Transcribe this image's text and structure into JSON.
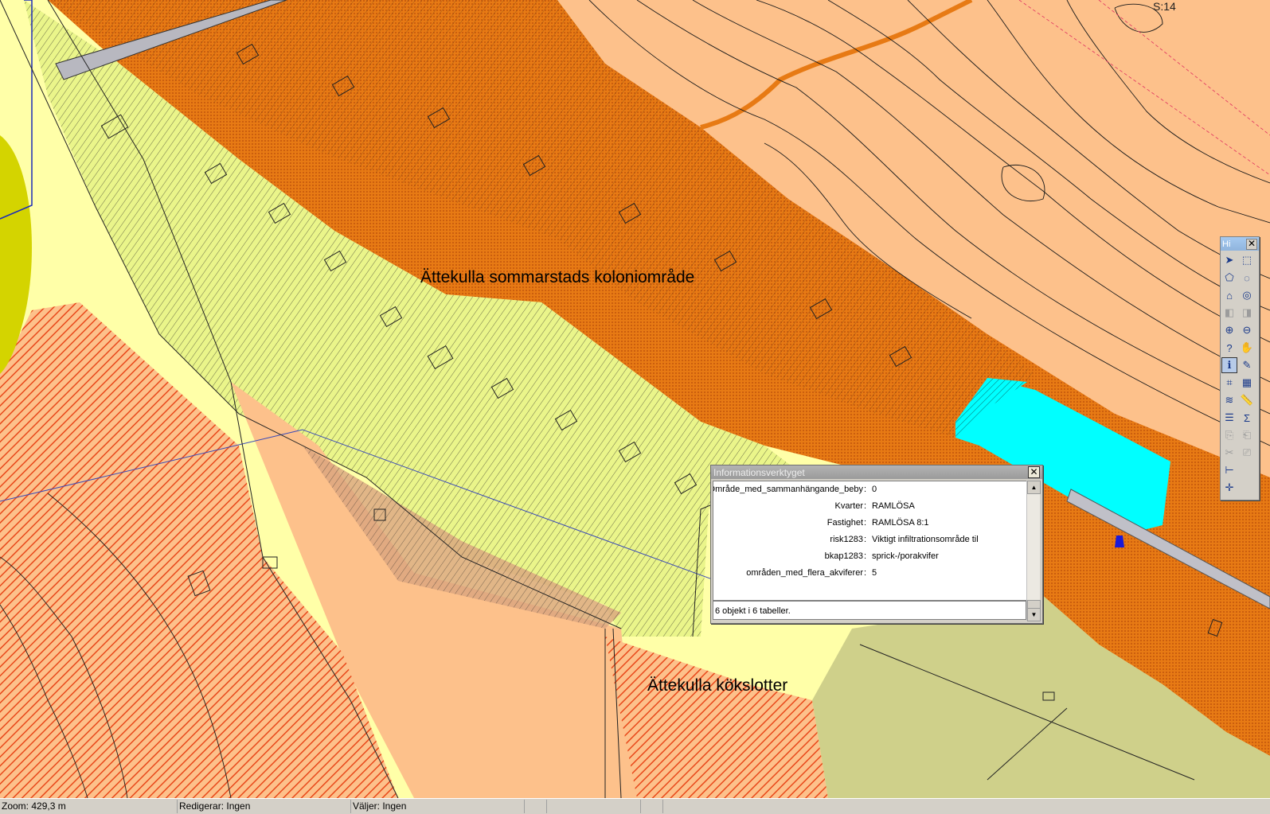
{
  "map": {
    "labels": {
      "koloni": "Ättekulla sommarstads koloniområde",
      "kokslotter": "Ättekulla kökslotter"
    },
    "grid_label": "S:14",
    "colors": {
      "bright_yellow": "#ffffa8",
      "light_orange": "#fdc18b",
      "dark_orange": "#e77a14",
      "olive": "#cfd08a",
      "cyan": "#00ffff",
      "yellow_green": "#d4d400",
      "grey_road": "#b8b8c0"
    }
  },
  "toolbox": {
    "title": "Hi",
    "tools": [
      {
        "name": "select-arrow-icon",
        "glyph": "➤"
      },
      {
        "name": "select-rectangle-icon",
        "glyph": "⬚"
      },
      {
        "name": "select-polygon-icon",
        "glyph": "⬠"
      },
      {
        "name": "select-radius-icon",
        "glyph": "◌"
      },
      {
        "name": "home-icon",
        "glyph": "⌂"
      },
      {
        "name": "full-extent-icon",
        "glyph": "◎"
      },
      {
        "name": "previous-view-icon",
        "glyph": "◧"
      },
      {
        "name": "next-view-icon",
        "glyph": "◨"
      },
      {
        "name": "zoom-in-icon",
        "glyph": "⊕"
      },
      {
        "name": "zoom-out-icon",
        "glyph": "⊖"
      },
      {
        "name": "help-icon",
        "glyph": "?"
      },
      {
        "name": "pan-hand-icon",
        "glyph": "✋"
      },
      {
        "name": "info-tool-icon",
        "glyph": "ℹ"
      },
      {
        "name": "pencil-icon",
        "glyph": "✎"
      },
      {
        "name": "label-tag-icon",
        "glyph": "⌗"
      },
      {
        "name": "map-export-icon",
        "glyph": "▦"
      },
      {
        "name": "layers-icon",
        "glyph": "≋"
      },
      {
        "name": "measure-ruler-icon",
        "glyph": "📏"
      },
      {
        "name": "table-icon",
        "glyph": "☰"
      },
      {
        "name": "sum-sigma-icon",
        "glyph": "Σ"
      },
      {
        "name": "copy-icon",
        "glyph": "⎘"
      },
      {
        "name": "paste-icon",
        "glyph": "⎗"
      },
      {
        "name": "cut-icon",
        "glyph": "✂"
      },
      {
        "name": "edit-icon",
        "glyph": "⎚"
      },
      {
        "name": "scale-bar-icon",
        "glyph": "⊢"
      },
      {
        "name": "blank-icon",
        "glyph": ""
      },
      {
        "name": "crosshair-icon",
        "glyph": "✛"
      },
      {
        "name": "blank2-icon",
        "glyph": ""
      }
    ]
  },
  "info_dialog": {
    "title": "Informationsverktyget",
    "rows": [
      {
        "key": "Område_med_sammanhängande_beby",
        "value": "0"
      },
      {
        "key": "Kvarter",
        "value": "RAMLÖSA"
      },
      {
        "key": "Fastighet",
        "value": "RAMLÖSA 8:1"
      },
      {
        "key": "risk1283",
        "value": "Viktigt infiltrationsområde til"
      },
      {
        "key": "bkap1283",
        "value": "sprick-/porakvifer"
      },
      {
        "key": "områden_med_flera_akviferer",
        "value": "5"
      }
    ],
    "status": "6 objekt i 6 tabeller."
  },
  "statusbar": {
    "zoom": "Zoom: 429,3 m",
    "editing": "Redigerar: Ingen",
    "selecting": "Väljer: Ingen"
  }
}
